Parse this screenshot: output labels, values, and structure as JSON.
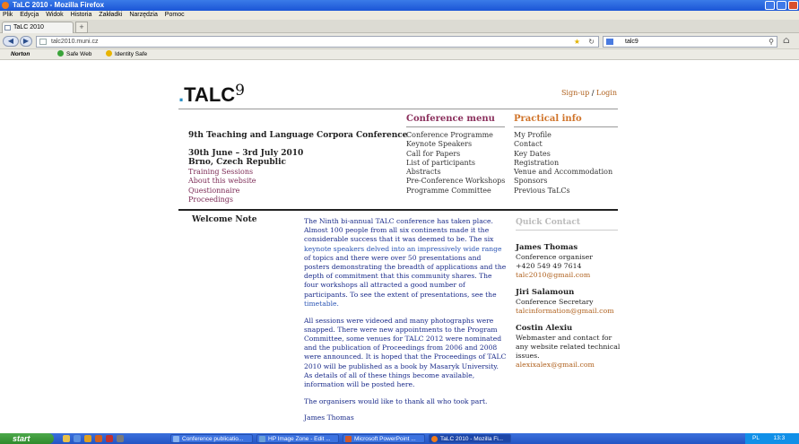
{
  "window": {
    "title": "TaLC 2010 - Mozilla Firefox"
  },
  "menubar": [
    "Plik",
    "Edycja",
    "Widok",
    "Historia",
    "Zakładki",
    "Narzędzia",
    "Pomoc"
  ],
  "tab": {
    "label": "TaLC 2010",
    "newtab": "+"
  },
  "nav": {
    "url": "talc2010.muni.cz",
    "search": "talc9"
  },
  "toolbar": {
    "norton": "Norton",
    "safeweb": "Safe Web",
    "identity": "Identity Safe"
  },
  "page": {
    "logo_text": "TALC",
    "logo_sup": "9",
    "signup": "Sign-up",
    "slash": "/",
    "login": "Login",
    "conf_menu_title": "Conference menu",
    "practical_title": "Practical info",
    "conf_menu": [
      "Conference Programme",
      "Keynote Speakers",
      "Call for Papers",
      "List of participants",
      "Abstracts",
      "Pre-Conference Workshops",
      "Programme Committee"
    ],
    "practical": [
      "My Profile",
      "Contact",
      "Key Dates",
      "Registration",
      "Venue and Accommodation",
      "Sponsors",
      "Previous TaLCs"
    ],
    "conf_title": "9th Teaching and Language Corpora Conference",
    "conf_date": "30th June – 3rd July 2010",
    "conf_place": "Brno, Czech Republic",
    "left_links": [
      "Training Sessions",
      "About this website",
      "Questionnaire",
      "Proceedings"
    ],
    "welcome": "Welcome Note",
    "p1": [
      "The Ninth bi-annual TALC conference has taken place.",
      "Almost 100 people from all six continents made it the",
      "considerable success that it was deemed to be. The six",
      "keynote speakers delved into an impressively wide range",
      "of topics and there were over 50 presentations and",
      "posters demonstrating the breadth of applications and the",
      "depth of commitment that this community shares. The",
      "four workshops all attracted a good number of",
      "participants. To see the extent of presentations, see the",
      "timetable."
    ],
    "p2": [
      " All sessions were videoed and many photographs were",
      "snapped. There were new appointments to the Program",
      "Committee, some venues for TALC 2012 were nominated",
      "and the publication of Proceedings from 2006 and 2008",
      "were announced. It is hoped that the Proceedings of TALC",
      "2010 will be published as a book by Masaryk University.",
      "As details of all of these things become available,",
      "information will be posted here."
    ],
    "p3": " The organisers would like to thank all who took part.",
    "p4": "James Thomas",
    "quick_contact": "Quick Contact",
    "contacts": [
      {
        "name": "James Thomas",
        "role": "Conference organiser",
        "phone": "+420 549 49 7614",
        "email": "talc2010@gmail.com"
      },
      {
        "name": "Jiri Salamoun",
        "role": "Conference Secretary",
        "email": "talcinformation@gmail.com"
      },
      {
        "name": "Costin Alexiu",
        "role_lines": [
          "Webmaster and contact for",
          "any website related technical",
          "issues."
        ],
        "email": "alexixalex@gmail.com"
      }
    ]
  },
  "taskbar": {
    "start": "start",
    "buttons": [
      "Conference publicatio...",
      "HP Image Zone - Edit ...",
      "Microsoft PowerPoint ...",
      "TaLC 2010 - Mozilla Fi..."
    ],
    "lang": "PL",
    "clock": "13:3"
  },
  "colors": {
    "accent": "#b0621f",
    "heading_orange": "#d0742a",
    "heading_plum": "#8a2f5c",
    "body_blue": "#1a2b8a"
  }
}
